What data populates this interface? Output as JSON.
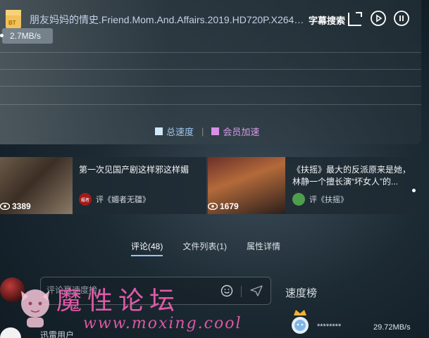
{
  "download": {
    "file_badge": "BT",
    "title": "朋友妈妈的情史.Friend.Mom.And.Affairs.2019.HD720P.X264.A...",
    "subtitle_search": "字幕搜索",
    "speed": "2.7MB/s",
    "legend_total": "总速度",
    "legend_vip": "会员加速",
    "legend_separator": "|",
    "colors": {
      "total": "#cfe8f8",
      "vip": "#d98fe8"
    }
  },
  "recommendations": [
    {
      "views": "3389",
      "title": "第一次见国产剧这样邪这样媚",
      "avatar_text": "媚者",
      "meta": "评《媚者无疆》"
    },
    {
      "views": "1679",
      "title": "《扶摇》最大的反派原来是她，林静一个擅长演“坏女人”的...",
      "meta": "评《扶摇》"
    }
  ],
  "tabs": [
    {
      "label": "评论(48)",
      "active": true
    },
    {
      "label": "文件列表(1)",
      "active": false
    },
    {
      "label": "属性详情",
      "active": false
    }
  ],
  "comment": {
    "placeholder": "评论赢速度榜"
  },
  "speed_rank": {
    "title": "速度榜",
    "user": "********",
    "speed": "29.72MB/s"
  },
  "next_user": "迅雷用户",
  "watermark": {
    "title": "魔性论坛",
    "url": "www.moxing.cool"
  }
}
